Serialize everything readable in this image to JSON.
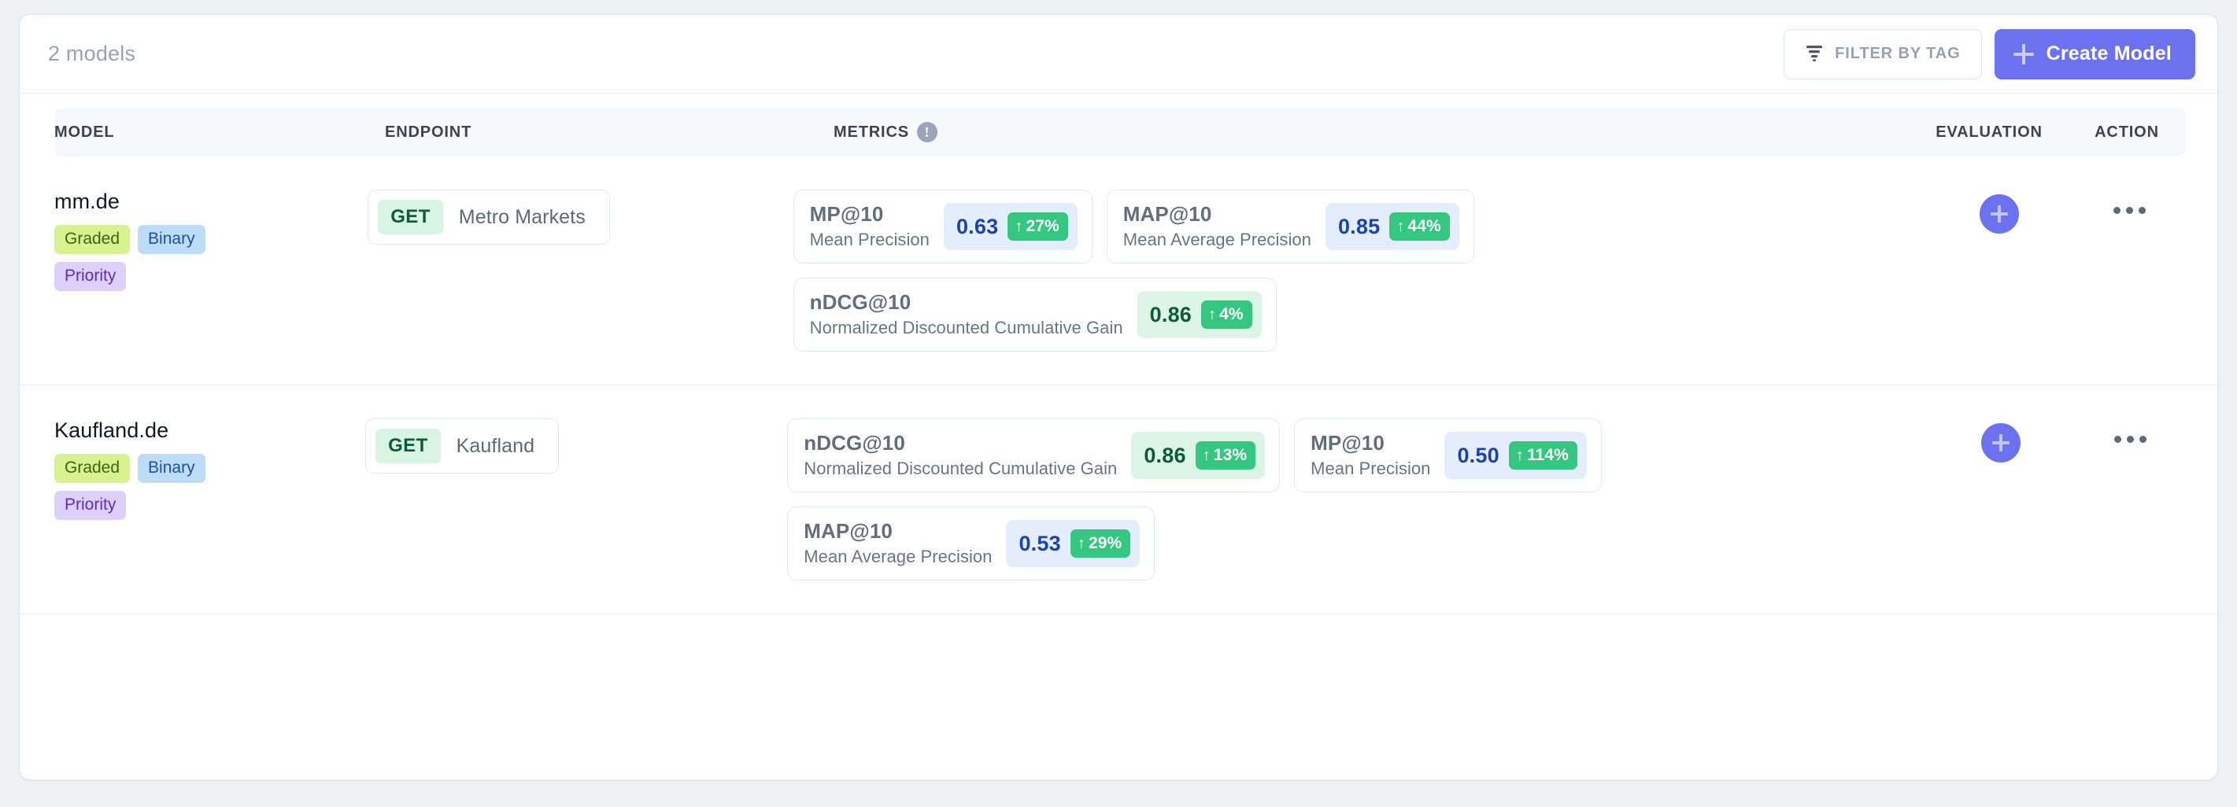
{
  "toolbar": {
    "models_count": "2 models",
    "filter_label": "FILTER BY TAG",
    "filter_icon": "filter-icon",
    "create_label": "Create Model",
    "create_icon": "plus-icon",
    "accent_color": "#6c71f0"
  },
  "table": {
    "headers": {
      "model": "MODEL",
      "endpoint": "ENDPOINT",
      "metrics": "METRICS",
      "metrics_info_icon": "info-icon",
      "metrics_info_glyph": "!",
      "evaluation": "EVALUATION",
      "action": "ACTION"
    },
    "rows": [
      {
        "model": {
          "name": "mm.de",
          "tags": [
            {
              "label": "Graded",
              "style": "graded"
            },
            {
              "label": "Binary",
              "style": "binary"
            },
            {
              "label": "Priority",
              "style": "priority"
            }
          ]
        },
        "endpoint": {
          "method": "GET",
          "name": "Metro Markets"
        },
        "metrics": [
          {
            "title": "MP@10",
            "subtitle": "Mean Precision",
            "value": "0.63",
            "delta": "27%",
            "delta_direction": "↑",
            "pill_style": "blue"
          },
          {
            "title": "MAP@10",
            "subtitle": "Mean Average Precision",
            "value": "0.85",
            "delta": "44%",
            "delta_direction": "↑",
            "pill_style": "blue"
          },
          {
            "title": "nDCG@10",
            "subtitle": "Normalized Discounted Cumulative Gain",
            "value": "0.86",
            "delta": "4%",
            "delta_direction": "↑",
            "pill_style": "green"
          }
        ],
        "evaluation_button_icon": "plus-icon",
        "action_button_icon": "ellipsis-icon"
      },
      {
        "model": {
          "name": "Kaufland.de",
          "tags": [
            {
              "label": "Graded",
              "style": "graded"
            },
            {
              "label": "Binary",
              "style": "binary"
            },
            {
              "label": "Priority",
              "style": "priority"
            }
          ]
        },
        "endpoint": {
          "method": "GET",
          "name": "Kaufland"
        },
        "metrics": [
          {
            "title": "nDCG@10",
            "subtitle": "Normalized Discounted Cumulative Gain",
            "value": "0.86",
            "delta": "13%",
            "delta_direction": "↑",
            "pill_style": "green"
          },
          {
            "title": "MP@10",
            "subtitle": "Mean Precision",
            "value": "0.50",
            "delta": "114%",
            "delta_direction": "↑",
            "pill_style": "blue"
          },
          {
            "title": "MAP@10",
            "subtitle": "Mean Average Precision",
            "value": "0.53",
            "delta": "29%",
            "delta_direction": "↑",
            "pill_style": "blue"
          }
        ],
        "evaluation_button_icon": "plus-icon",
        "action_button_icon": "ellipsis-icon"
      }
    ]
  }
}
